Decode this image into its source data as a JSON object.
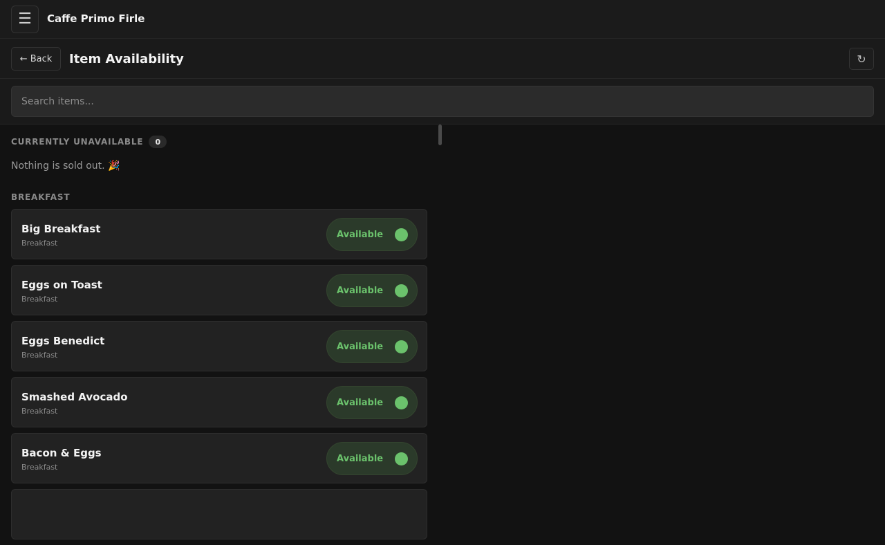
{
  "app": {
    "title": "Caffe Primo Firle",
    "menu_icon": "☰"
  },
  "subheader": {
    "back_label": "← Back",
    "page_title": "Item Availability",
    "refresh_icon": "↻"
  },
  "search": {
    "placeholder": "Search items..."
  },
  "unavailable": {
    "heading": "CURRENTLY UNAVAILABLE",
    "count": "0",
    "empty_message": "Nothing is sold out. 🎉"
  },
  "breakfast": {
    "heading": "BREAKFAST",
    "items": [
      {
        "name": "Big Breakfast",
        "category": "Breakfast",
        "status": "Available"
      },
      {
        "name": "Eggs on Toast",
        "category": "Breakfast",
        "status": "Available"
      },
      {
        "name": "Eggs Benedict",
        "category": "Breakfast",
        "status": "Available"
      },
      {
        "name": "Smashed Avocado",
        "category": "Breakfast",
        "status": "Available"
      },
      {
        "name": "Bacon & Eggs",
        "category": "Breakfast",
        "status": "Available"
      }
    ]
  },
  "colors": {
    "available_green": "#6bc26c",
    "background": "#121212",
    "card": "#222222"
  }
}
